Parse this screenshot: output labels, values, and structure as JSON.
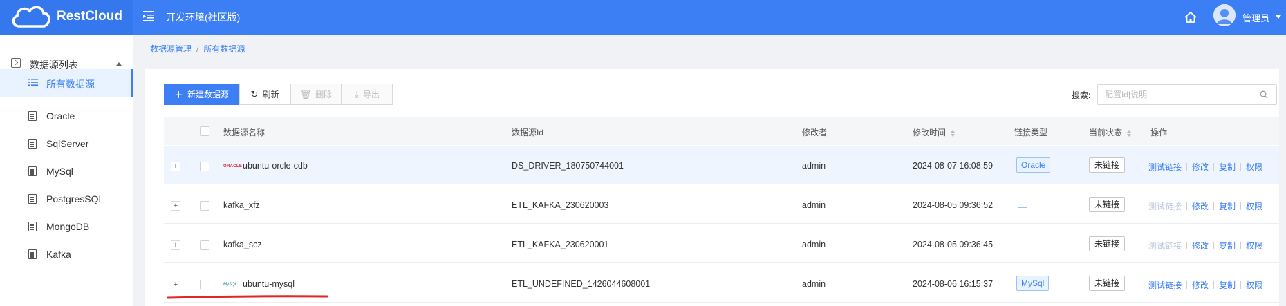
{
  "header": {
    "brand": "RestCloud",
    "env_title": "开发环境(社区版)",
    "user": "管理员"
  },
  "sidebar": {
    "group_label": "数据源列表",
    "items": [
      {
        "label": "所有数据源",
        "active": true
      },
      {
        "label": "Oracle"
      },
      {
        "label": "SqlServer"
      },
      {
        "label": "MySql"
      },
      {
        "label": "PostgresSQL"
      },
      {
        "label": "MongoDB"
      },
      {
        "label": "Kafka"
      }
    ]
  },
  "breadcrumb": {
    "parent": "数据源管理",
    "separator": "/",
    "current": "所有数据源"
  },
  "toolbar": {
    "new_label": "新建数据源",
    "refresh_label": "刷新",
    "delete_label": "删除",
    "export_label": "导出",
    "search_label": "搜索:",
    "search_placeholder": "配置Id|说明"
  },
  "table": {
    "columns": {
      "name": "数据源名称",
      "id": "数据源Id",
      "modifier": "修改者",
      "modified_time": "修改时间",
      "link_type": "链接类型",
      "status": "当前状态",
      "actions": "操作"
    },
    "rows": [
      {
        "logo": "ORACLE",
        "name": "ubuntu-orcle-cdb",
        "id": "DS_DRIVER_180750744001",
        "modifier": "admin",
        "time": "2024-08-07 16:08:59",
        "type": "Oracle",
        "status": "未链接",
        "test_enabled": true
      },
      {
        "logo": "",
        "name": "kafka_xfz",
        "id": "ETL_KAFKA_230620003",
        "modifier": "admin",
        "time": "2024-08-05 09:36:52",
        "type": "",
        "status": "未链接",
        "test_enabled": false
      },
      {
        "logo": "",
        "name": "kafka_scz",
        "id": "ETL_KAFKA_230620001",
        "modifier": "admin",
        "time": "2024-08-05 09:36:45",
        "type": "",
        "status": "未链接",
        "test_enabled": false
      },
      {
        "logo": "MySQL",
        "name": "ubuntu-mysql",
        "id": "ETL_UNDEFINED_1426044608001",
        "modifier": "admin",
        "time": "2024-08-06 16:15:37",
        "type": "MySql",
        "status": "未链接",
        "test_enabled": true
      }
    ],
    "actions": {
      "test": "测试链接",
      "edit": "修改",
      "copy": "复制",
      "perm": "权限"
    }
  },
  "colors": {
    "primary": "#3c7ff5",
    "header_bg": "#3c7ff5",
    "logo_bg": "#3577ed",
    "highlight_row": "#eef5ff",
    "annotation_red": "#e0262b"
  }
}
